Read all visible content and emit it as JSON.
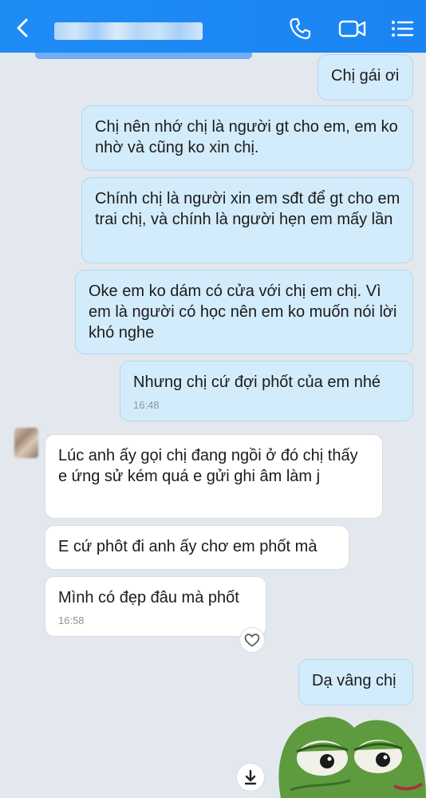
{
  "messages": [
    {
      "side": "out",
      "text": "Chị gái ơi"
    },
    {
      "side": "out",
      "text": "Chị nên nhớ chị là người gt cho em, em ko nhờ và cũng ko xin chị."
    },
    {
      "side": "out",
      "text": "Chính chị là người xin em sđt để gt cho em trai chị, và chính là người hẹn em mấy lần"
    },
    {
      "side": "out",
      "text": "Oke em ko dám có cửa với chị em chị. Vì em là người có học nên em ko muốn nói lời khó nghe"
    },
    {
      "side": "out",
      "text": "Nhưng chị cứ đợi phốt của em nhé",
      "time": "16:48"
    },
    {
      "side": "in",
      "text": "Lúc anh ấy gọi chị đang ngồi ở đó chị thấy e ứng sử kém quá e gửi ghi âm làm j"
    },
    {
      "side": "in",
      "text": "E cứ phôt đi anh ấy chơ em phốt mà"
    },
    {
      "side": "in",
      "text": "Mình có đẹp đâu mà phốt",
      "time": "16:58"
    },
    {
      "side": "out",
      "text": "Dạ vâng chị"
    }
  ],
  "icons": {
    "back": "chevron-left-icon",
    "call": "phone-icon",
    "video": "video-camera-icon",
    "menu": "list-menu-icon",
    "reaction": "heart-icon",
    "download": "download-icon",
    "sticker": "pepe-frog-sticker"
  },
  "colors": {
    "header": "#1f8cf6",
    "background": "#e3e8ee",
    "outgoing_bubble": "#d3ecfb",
    "incoming_bubble": "#ffffff"
  }
}
